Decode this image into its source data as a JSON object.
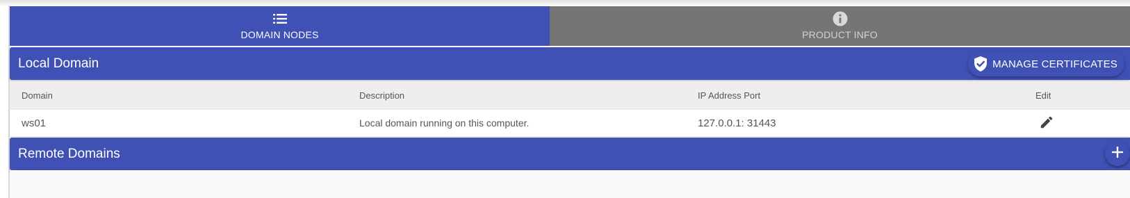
{
  "tabs": [
    {
      "label": "DOMAIN NODES",
      "icon": "list-icon",
      "active": true
    },
    {
      "label": "PRODUCT INFO",
      "icon": "info-icon",
      "active": false
    }
  ],
  "local_domain": {
    "title": "Local Domain",
    "manage_certificates_label": "MANAGE CERTIFICATES",
    "table": {
      "headers": {
        "domain": "Domain",
        "description": "Description",
        "ip_port": "IP Address Port",
        "edit": "Edit"
      },
      "rows": [
        {
          "domain": "ws01",
          "description": "Local domain running on this computer.",
          "ip_port": "127.0.0.1: 31443"
        }
      ]
    }
  },
  "remote_domains": {
    "title": "Remote Domains",
    "add_icon": "plus-icon"
  },
  "colors": {
    "primary": "#3f51b5",
    "inactive_tab": "#757575",
    "table_header_bg": "#eeeeee"
  }
}
